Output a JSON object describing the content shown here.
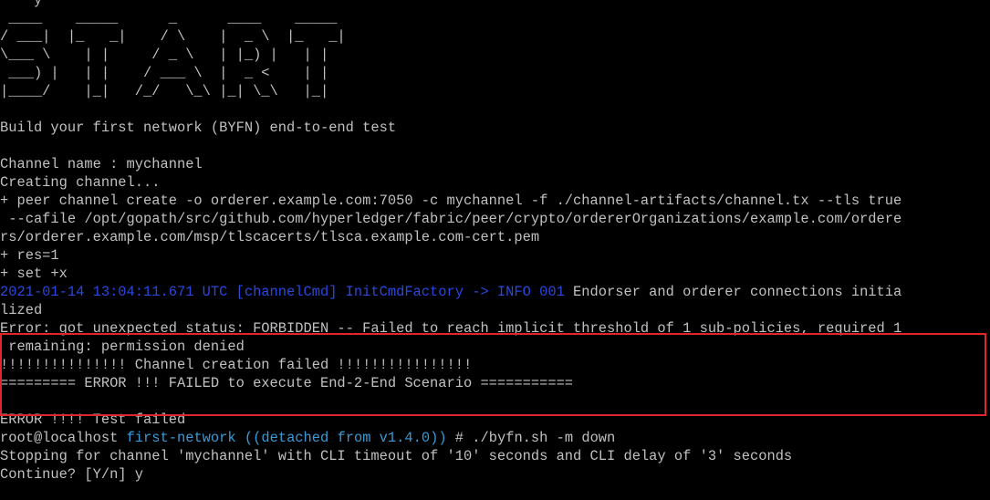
{
  "colors": {
    "background": "#000000",
    "text": "#c0c0c0",
    "log_info": "#2a48e0",
    "prompt_dir": "#3a9bd8",
    "highlight_border": "#e0262a"
  },
  "terminal": {
    "top_partial": "    y",
    "banner": [
      " ____    _____      _      ____    _____",
      "/ ___|  |_   _|    / \\    |  _ \\  |_   _|",
      "\\___ \\    | |     / _ \\   | |_) |   | |",
      " ___) |   | |    / ___ \\  |  _ <    | |",
      "|____/    |_|   /_/   \\_\\ |_| \\_\\   |_|"
    ],
    "subtitle": "Build your first network (BYFN) end-to-end test",
    "channel_name": "Channel name : mychannel",
    "creating": "Creating channel...",
    "cmd_line1": "+ peer channel create -o orderer.example.com:7050 -c mychannel -f ./channel-artifacts/channel.tx --tls true",
    "cmd_line2": " --cafile /opt/gopath/src/github.com/hyperledger/fabric/peer/crypto/ordererOrganizations/example.com/ordere",
    "cmd_line3": "rs/orderer.example.com/msp/tlscacerts/tlsca.example.com-cert.pem",
    "res": "+ res=1",
    "set_x": "+ set +x",
    "log_prefix": "2021-01-14 13:04:11.671 UTC [channelCmd] InitCmdFactory -> INFO 001",
    "log_msg": " Endorser and orderer connections initia",
    "log_cont": "lized",
    "error_line1": "Error: got unexpected status: FORBIDDEN -- Failed to reach implicit threshold of 1 sub-policies, required 1",
    "error_line2": " remaining: permission denied",
    "fail_line": "!!!!!!!!!!!!!!! Channel creation failed !!!!!!!!!!!!!!!!",
    "scenario_fail": "========= ERROR !!! FAILED to execute End-2-End Scenario ===========",
    "test_failed": "ERROR !!!! Test failed",
    "prompt_user": "root@localhost",
    "prompt_dir": "first-network",
    "prompt_branch": "((detached from v1.4.0))",
    "prompt_cmd": " # ./byfn.sh -m down",
    "stopping": "Stopping for channel 'mychannel' with CLI timeout of '10' seconds and CLI delay of '3' seconds",
    "continue": "Continue? [Y/n] y"
  }
}
